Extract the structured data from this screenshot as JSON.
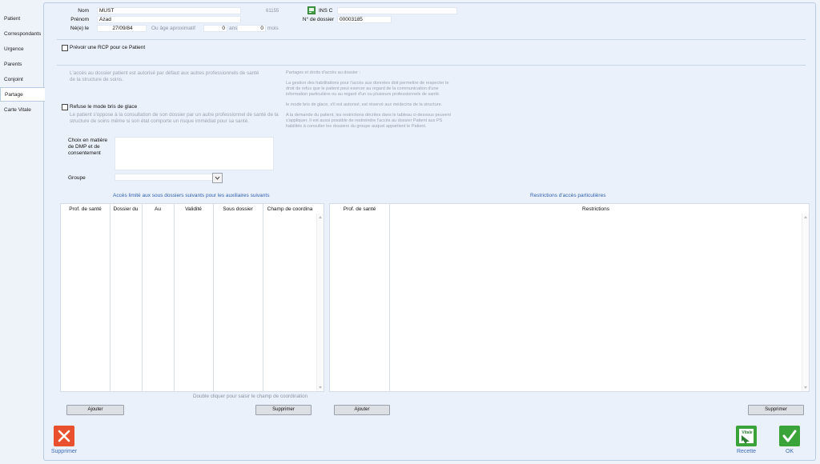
{
  "tabs": [
    "Patient",
    "Correspondants",
    "Urgence",
    "Parents",
    "Conjoint",
    "Partage",
    "Carte Vitale"
  ],
  "active_tab": "Partage",
  "identity": {
    "nom_label": "Nom",
    "nom_value": "MUST",
    "prenom_label": "Prénom",
    "prenom_value": "Azad",
    "ne_label": "Né(e) le",
    "ne_value": "27/09/84",
    "age_label": "Ou âge aproximatif",
    "ans_value": "0",
    "ans_label": "ans",
    "mois_value": "0",
    "mois_label": "mois",
    "id_number": "61155",
    "insc_label": "INS C",
    "insc_value": "",
    "dossier_label": "N° de dossier",
    "dossier_value": "00003185"
  },
  "rcp": {
    "label": "Prévoir une RCP pour ce Patient",
    "checked": false
  },
  "info_left": "L'accès au dossier patient est autorisé par défaut aux autres professionnels de santé de la structure de soins.",
  "info_right": {
    "title": "Partages et droits d'accès au dossier :",
    "p1": "La gestion des habilitations pour l'accès aux données doit permettre de respecter le droit de refus que le patient peut exercer au regard de la communication d'une information particulière ou au regard d'un ou plusieurs professionnels de santé.",
    "p2": "le mode bris de glace, s'il est autorisé, est réservé aux médecins de la structure.",
    "p3": "A la demande du patient, les restrictions décrites dans le tableau ci-dessous peuvent s'appliquer. Il est aussi possible de restreindre l'accès au dossier Patient aux PS habilités à consulter les dossiers du groupe auquel appartient le Patient."
  },
  "bris": {
    "label": "Refuse le mode bris de glace",
    "checked": false,
    "desc": "Le patient s'oppose à la consultation de son dossier par un autre professionnel de santé de la structure de soins même si son état comporte un risque immédiat pour sa santé."
  },
  "dmp": {
    "label": "Choix en matière de DMP et de consentement",
    "value": ""
  },
  "groupe": {
    "label": "Groupe",
    "value": ""
  },
  "left_table": {
    "title": "Accès limité aux sous dossiers suivants pour les auxiliaires suivants",
    "columns": [
      "Prof. de santé",
      "Dossier du",
      "Au",
      "Validité",
      "Sous dossier",
      "Champ de coordina"
    ],
    "hint": "Double cliquer pour saisir le champ de coordination",
    "add_label": "Ajouter",
    "delete_label": "Supprimer"
  },
  "right_table": {
    "title": "Restrictions d'accès particulières",
    "columns": [
      "Prof. de santé",
      "Restrictions"
    ],
    "add_label": "Ajouter",
    "delete_label": "Supprimer"
  },
  "footer": {
    "delete_label": "Supprimer",
    "recette_label": "Recette",
    "ok_label": "OK",
    "vitale_badge": "Vitale"
  },
  "colors": {
    "red": "#e8502e",
    "green": "#3aa33a",
    "accent_blue": "#2f5fb0"
  }
}
